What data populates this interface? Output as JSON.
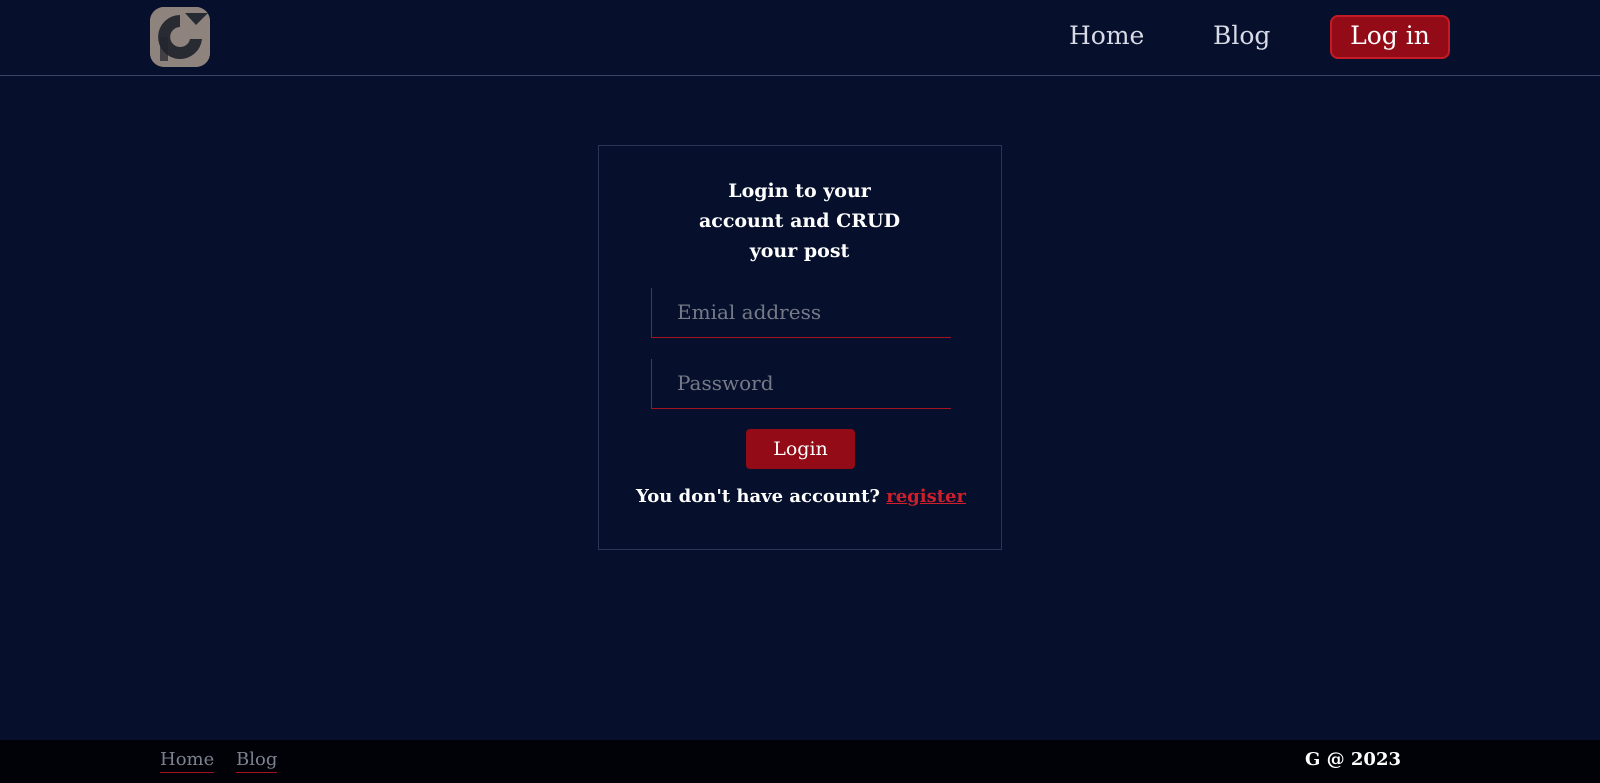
{
  "header": {
    "logo_alt": "logo",
    "nav": {
      "home": "Home",
      "blog": "Blog",
      "login": "Log in"
    }
  },
  "login_card": {
    "title": "Login to your account and CRUD your post",
    "email_placeholder": "Emial address",
    "password_placeholder": "Password",
    "submit_label": "Login",
    "register_prompt": "You don't have account?",
    "register_link": "register"
  },
  "footer": {
    "links": {
      "home": "Home",
      "blog": "Blog"
    },
    "copyright": "G @ 2023"
  },
  "colors": {
    "background": "#06102d",
    "accent": "#920b16",
    "link": "#cf1f2d",
    "footer_bg": "#000207"
  }
}
